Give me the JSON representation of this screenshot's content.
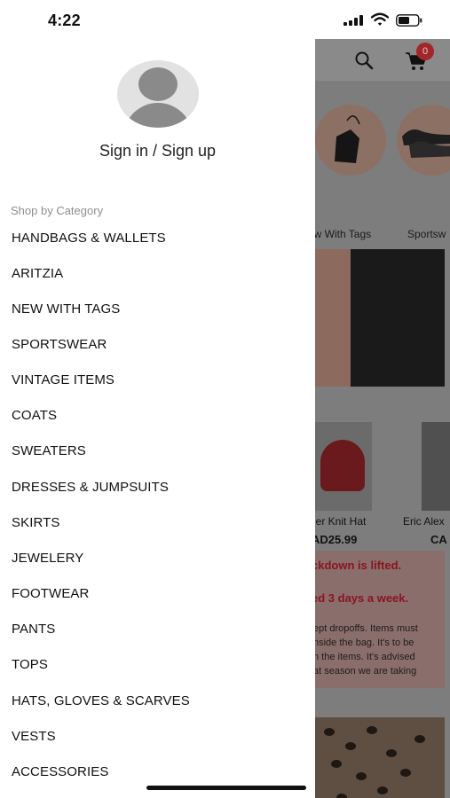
{
  "status_bar": {
    "time": "4:22"
  },
  "drawer": {
    "account_label": "Sign in / Sign up",
    "section_title": "Shop by Category",
    "categories": [
      "HANDBAGS & WALLETS",
      "ARITZIA",
      "NEW WITH TAGS",
      "SPORTSWEAR",
      "VINTAGE ITEMS",
      "COATS",
      "SWEATERS",
      "DRESSES & JUMPSUITS",
      "SKIRTS",
      "JEWELERY",
      "FOOTWEAR",
      "PANTS",
      "TOPS",
      "HATS, GLOVES & SCARVES",
      "VESTS",
      "ACCESSORIES"
    ]
  },
  "background": {
    "cart_count": "0",
    "circle_categories": [
      "ew With Tags",
      "Sportsw"
    ],
    "products": [
      {
        "name": "ier Knit Hat",
        "price": "AD25.99"
      },
      {
        "name": "Eric Alex",
        "price": "CA"
      }
    ],
    "notice": {
      "heading_1": "ckdown is lifted.",
      "heading_2": "ed 3 days a week.",
      "lines": [
        "ept dropoffs. Items must",
        "nside the bag. It's to be",
        "n the items. It's advised",
        "at season we are taking"
      ]
    }
  },
  "colors": {
    "badge": "#a3262a",
    "notice_heading": "#8a1422"
  },
  "icons": [
    "search-icon",
    "cart-icon",
    "user-avatar-icon",
    "signal-icon",
    "wifi-icon",
    "battery-icon"
  ]
}
